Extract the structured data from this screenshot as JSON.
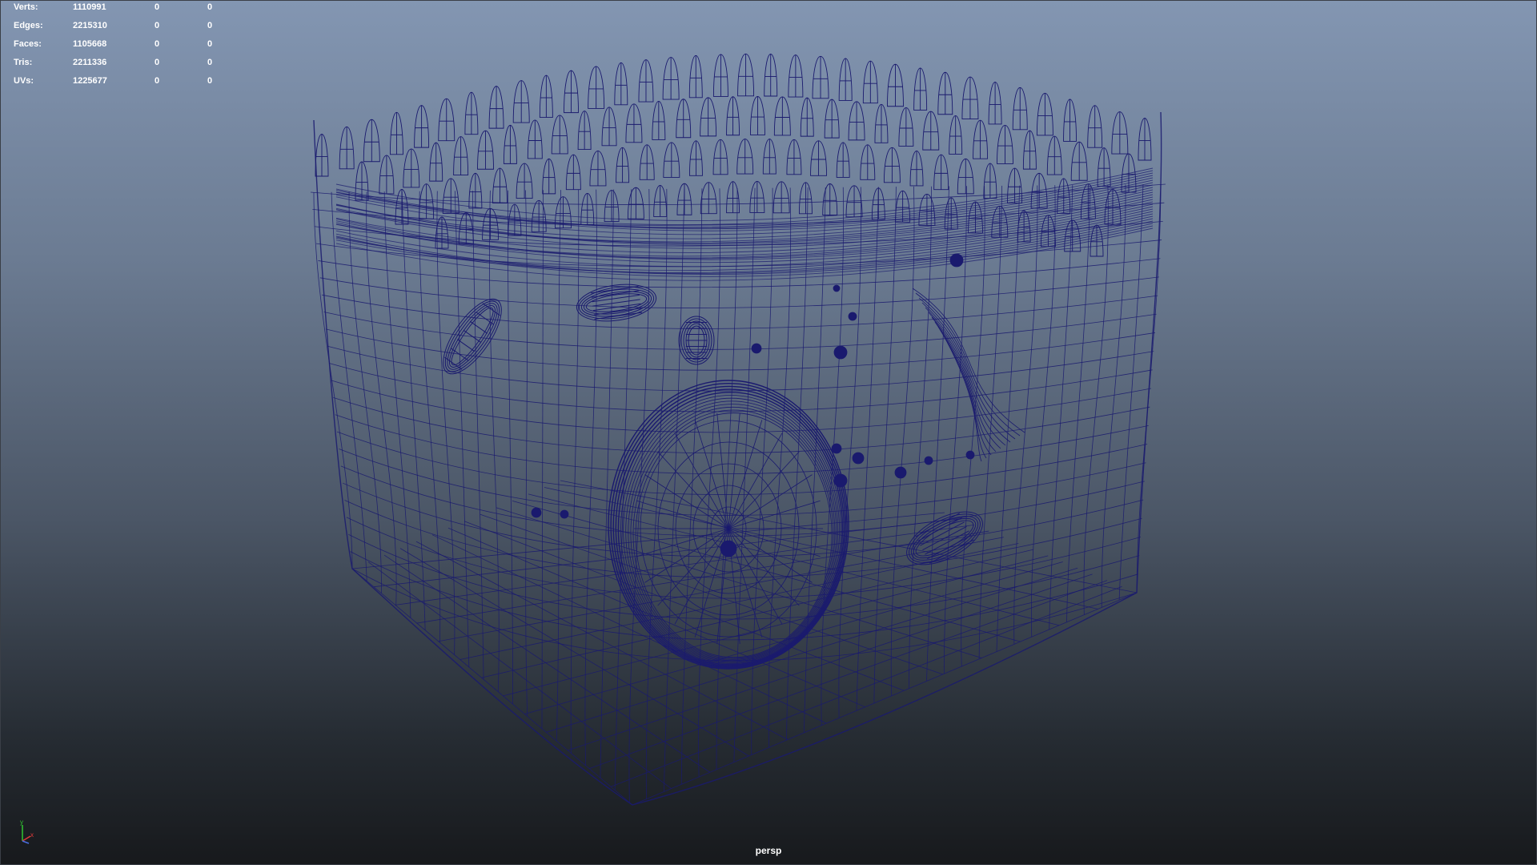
{
  "viewport": {
    "camera": "persp",
    "background_top": "#8396b2",
    "background_bottom": "#17191c",
    "wireframe_color": "#1a1a6e"
  },
  "hud": {
    "rows": [
      {
        "label": "Verts:",
        "total": "1110991",
        "selected": "0",
        "components": "0"
      },
      {
        "label": "Edges:",
        "total": "2215310",
        "selected": "0",
        "components": "0"
      },
      {
        "label": "Faces:",
        "total": "1105668",
        "selected": "0",
        "components": "0"
      },
      {
        "label": "Tris:",
        "total": "2211336",
        "selected": "0",
        "components": "0"
      },
      {
        "label": "UVs:",
        "total": "1225677",
        "selected": "0",
        "components": "0"
      }
    ]
  },
  "axis_gizmo": {
    "y_label": "y",
    "x_label": "x",
    "y_color": "#31c631",
    "x_color": "#e23a3a",
    "z_color": "#4a6ee0"
  }
}
